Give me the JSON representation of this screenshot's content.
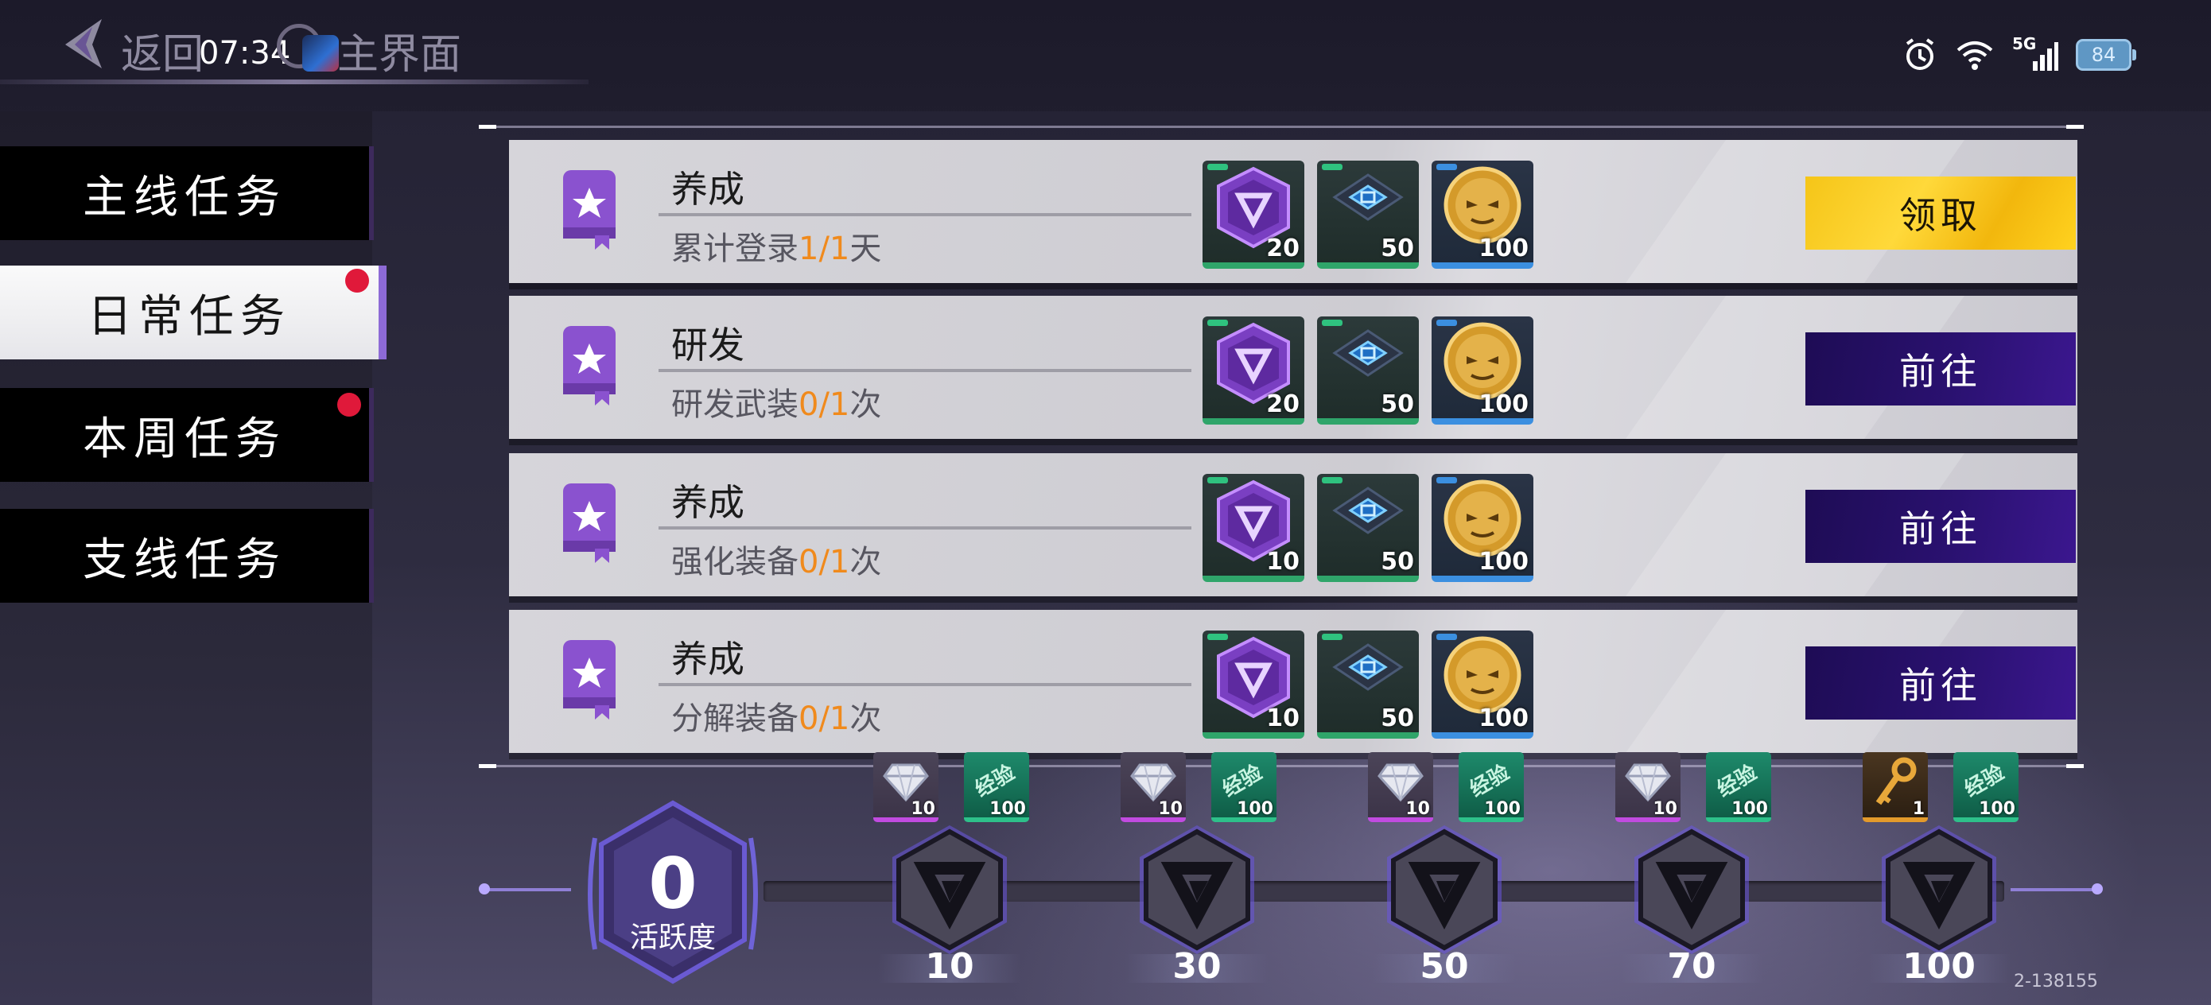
{
  "topbar": {
    "back_label": "返回",
    "clock": "07:34",
    "home_label": "主界面",
    "network": "5G",
    "battery": "84"
  },
  "tabs": [
    {
      "label": "主线任务",
      "active": false,
      "dot": false
    },
    {
      "label": "日常任务",
      "active": true,
      "dot": true
    },
    {
      "label": "本周任务",
      "active": false,
      "dot": true
    },
    {
      "label": "支线任务",
      "active": false,
      "dot": false
    }
  ],
  "tasks": [
    {
      "title": "养成",
      "desc_prefix": "累计登录",
      "progress": "1/1",
      "desc_suffix": "天",
      "rewards": [
        "20",
        "50",
        "100"
      ],
      "button": "领取",
      "button_type": "claim"
    },
    {
      "title": "研发",
      "desc_prefix": "研发武装",
      "progress": "0/1",
      "desc_suffix": "次",
      "rewards": [
        "20",
        "50",
        "100"
      ],
      "button": "前往",
      "button_type": "go"
    },
    {
      "title": "养成",
      "desc_prefix": "强化装备",
      "progress": "0/1",
      "desc_suffix": "次",
      "rewards": [
        "10",
        "50",
        "100"
      ],
      "button": "前往",
      "button_type": "go"
    },
    {
      "title": "养成",
      "desc_prefix": "分解装备",
      "progress": "0/1",
      "desc_suffix": "次",
      "rewards": [
        "10",
        "50",
        "100"
      ],
      "button": "前往",
      "button_type": "go"
    }
  ],
  "activity": {
    "value": "0",
    "label": "活跃度",
    "milestones": [
      {
        "value": "10",
        "reward1": {
          "kind": "diamond",
          "qty": "10"
        },
        "reward2": {
          "kind": "exp",
          "qty": "100",
          "label": "经验"
        }
      },
      {
        "value": "30",
        "reward1": {
          "kind": "diamond",
          "qty": "10"
        },
        "reward2": {
          "kind": "exp",
          "qty": "100",
          "label": "经验"
        }
      },
      {
        "value": "50",
        "reward1": {
          "kind": "diamond",
          "qty": "10"
        },
        "reward2": {
          "kind": "exp",
          "qty": "100",
          "label": "经验"
        }
      },
      {
        "value": "70",
        "reward1": {
          "kind": "diamond",
          "qty": "10"
        },
        "reward2": {
          "kind": "exp",
          "qty": "100",
          "label": "经验"
        }
      },
      {
        "value": "100",
        "reward1": {
          "kind": "key",
          "qty": "1"
        },
        "reward2": {
          "kind": "exp",
          "qty": "100",
          "label": "经验"
        }
      }
    ]
  },
  "version": "2-138155",
  "colors": {
    "accent": "#8d6ad6",
    "progress": "#f08a1c",
    "claim": "#f5c518",
    "go": "#2a1170",
    "dot": "#e0193a"
  }
}
